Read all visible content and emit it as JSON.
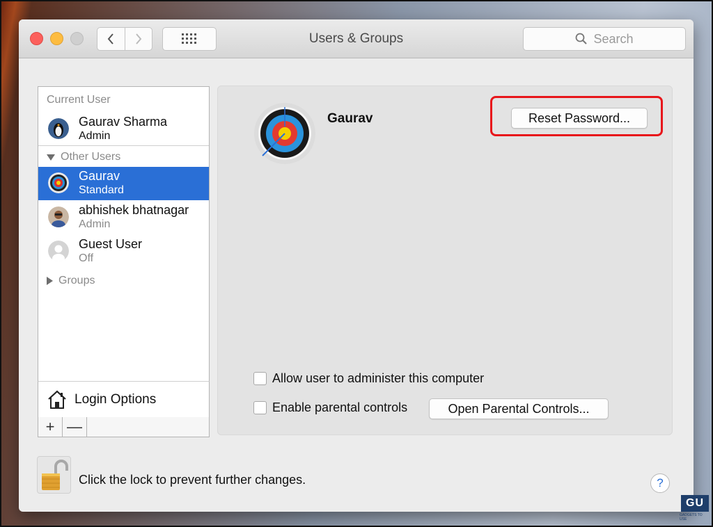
{
  "window": {
    "title": "Users & Groups",
    "search_placeholder": "Search"
  },
  "sidebar": {
    "current_user_header": "Current User",
    "current_user": {
      "name": "Gaurav Sharma",
      "role": "Admin"
    },
    "other_users_header": "Other Users",
    "other_users": [
      {
        "name": "Gaurav",
        "role": "Standard",
        "selected": true
      },
      {
        "name": "abhishek bhatnagar",
        "role": "Admin",
        "selected": false
      },
      {
        "name": "Guest User",
        "role": "Off",
        "selected": false
      }
    ],
    "groups_label": "Groups",
    "login_options_label": "Login Options",
    "add_label": "+",
    "remove_label": "—"
  },
  "detail": {
    "user_name": "Gaurav",
    "reset_password_label": "Reset Password...",
    "allow_admin_label": "Allow user to administer this computer",
    "allow_admin_checked": false,
    "parental_controls_label": "Enable parental controls",
    "parental_controls_checked": false,
    "open_parental_label": "Open Parental Controls..."
  },
  "footer": {
    "lock_text": "Click the lock to prevent further changes.",
    "help_label": "?"
  },
  "watermark": {
    "logo": "GU",
    "text": "GADGETS TO USE"
  },
  "colors": {
    "selection": "#2a6fd6",
    "highlight_border": "#e8161b",
    "close": "#fc605c",
    "minimize": "#fdbc40"
  }
}
